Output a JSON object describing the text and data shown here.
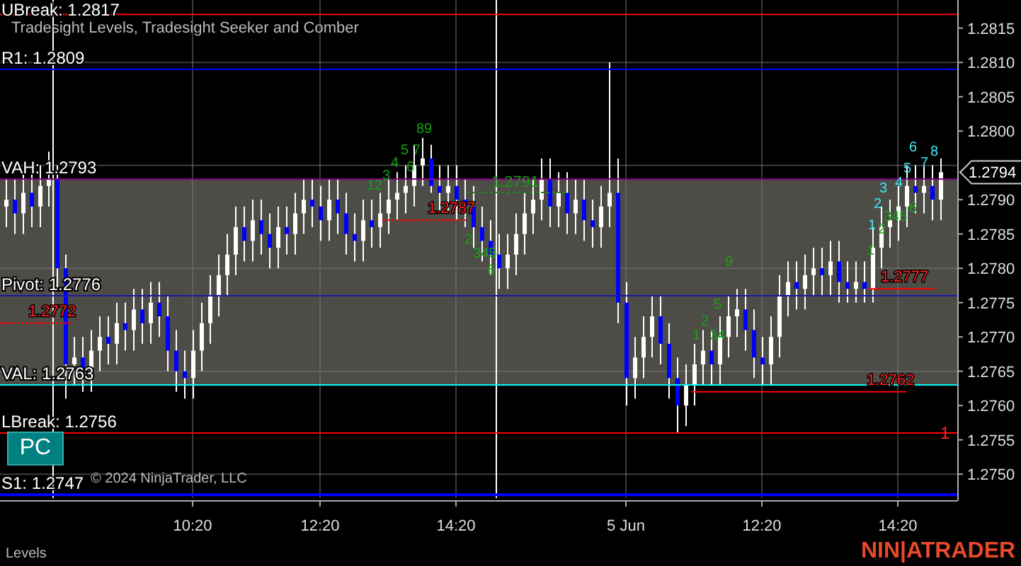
{
  "indicator_title": "Tradesight Levels, Tradesight Seeker and Comber",
  "levels": [
    {
      "name": "UBreak:",
      "price": "1.2817",
      "color": "#ff0000"
    },
    {
      "name": "R1:",
      "price": "1.2809",
      "color": "#0000ff"
    },
    {
      "name": "VAH:",
      "price": "1.2793",
      "color": "#800080"
    },
    {
      "name": "Pivot:",
      "price": "1.2776",
      "color": "#1a1aa8"
    },
    {
      "name": "VAL:",
      "price": "1.2763",
      "color": "#00ffff"
    },
    {
      "name": "LBreak:",
      "price": "1.2756",
      "color": "#ff0000"
    },
    {
      "name": "S1:",
      "price": "1.2747",
      "color": "#0000ff"
    }
  ],
  "red_markers": [
    "1.2787",
    "1.2772",
    "1.2777",
    "1.2762"
  ],
  "green_marker": "1.2791",
  "break_count": "1",
  "green_counts": [
    "89",
    "5 7",
    "4",
    "6",
    "3",
    "12",
    "2",
    "345",
    "6",
    "1",
    "2",
    "34",
    "5",
    "9",
    "1",
    "2",
    "345",
    "6"
  ],
  "cyan_counts": [
    "1",
    "2",
    "3",
    "4",
    "5",
    "6",
    "7",
    "8"
  ],
  "chart_data": {
    "type": "candlestick",
    "categories": [
      null,
      null,
      null,
      null,
      null,
      null,
      null,
      null,
      null,
      null,
      null,
      null,
      null,
      null,
      null,
      null,
      null,
      null,
      null,
      null,
      null,
      null,
      "10:20",
      null,
      null,
      null,
      null,
      null,
      null,
      null,
      null,
      null,
      null,
      null,
      null,
      null,
      null,
      "12:20",
      null,
      null,
      null,
      null,
      null,
      null,
      null,
      null,
      null,
      null,
      null,
      null,
      null,
      null,
      null,
      "14:20",
      null,
      null,
      null,
      null,
      null,
      null,
      null,
      null,
      null,
      null,
      null,
      null,
      null,
      null,
      null,
      null,
      null,
      null,
      null,
      "5 Jun",
      null,
      null,
      null,
      null,
      null,
      null,
      null,
      null,
      null,
      null,
      null,
      null,
      null,
      null,
      null,
      "12:20",
      null,
      null,
      null,
      null,
      null,
      null,
      null,
      null,
      null,
      null,
      null,
      null,
      null,
      null,
      null,
      "14:20",
      null,
      null,
      null,
      null,
      null
    ],
    "ohlc": [
      [
        1.2789,
        1.2793,
        1.2786,
        1.279
      ],
      [
        1.279,
        1.2793,
        1.2785,
        1.2788
      ],
      [
        1.2788,
        1.2794,
        1.2785,
        1.2791
      ],
      [
        1.2791,
        1.2794,
        1.2786,
        1.2789
      ],
      [
        1.2789,
        1.2795,
        1.2786,
        1.2792
      ],
      [
        1.2792,
        1.2797,
        1.2789,
        1.2793
      ],
      [
        1.2793,
        1.2795,
        1.2777,
        1.278
      ],
      [
        1.278,
        1.2782,
        1.2761,
        1.2766
      ],
      [
        1.2766,
        1.277,
        1.2763,
        1.2767
      ],
      [
        1.2767,
        1.277,
        1.2762,
        1.2765
      ],
      [
        1.2765,
        1.2771,
        1.2762,
        1.2768
      ],
      [
        1.2768,
        1.2773,
        1.2765,
        1.277
      ],
      [
        1.277,
        1.2773,
        1.2766,
        1.2769
      ],
      [
        1.2769,
        1.2775,
        1.2766,
        1.2772
      ],
      [
        1.2772,
        1.2775,
        1.2768,
        1.2771
      ],
      [
        1.2771,
        1.2777,
        1.2768,
        1.2774
      ],
      [
        1.2774,
        1.2777,
        1.2769,
        1.2772
      ],
      [
        1.2772,
        1.2778,
        1.2769,
        1.2775
      ],
      [
        1.2775,
        1.2778,
        1.277,
        1.2773
      ],
      [
        1.2773,
        1.2776,
        1.2765,
        1.2768
      ],
      [
        1.2768,
        1.2771,
        1.2762,
        1.2765
      ],
      [
        1.2765,
        1.2768,
        1.2761,
        1.2764
      ],
      [
        1.2764,
        1.2771,
        1.2761,
        1.2768
      ],
      [
        1.2768,
        1.2775,
        1.2765,
        1.2772
      ],
      [
        1.2772,
        1.2779,
        1.2769,
        1.2776
      ],
      [
        1.2776,
        1.2782,
        1.2773,
        1.2779
      ],
      [
        1.2779,
        1.2785,
        1.2776,
        1.2782
      ],
      [
        1.2782,
        1.2789,
        1.2779,
        1.2786
      ],
      [
        1.2786,
        1.2789,
        1.2781,
        1.2784
      ],
      [
        1.2784,
        1.279,
        1.2781,
        1.2787
      ],
      [
        1.2787,
        1.279,
        1.2782,
        1.2785
      ],
      [
        1.2785,
        1.2788,
        1.278,
        1.2783
      ],
      [
        1.2783,
        1.2789,
        1.278,
        1.2786
      ],
      [
        1.2786,
        1.2789,
        1.2782,
        1.2785
      ],
      [
        1.2785,
        1.2791,
        1.2782,
        1.2788
      ],
      [
        1.2788,
        1.2793,
        1.2785,
        1.279
      ],
      [
        1.279,
        1.2793,
        1.2786,
        1.2789
      ],
      [
        1.2789,
        1.2792,
        1.2784,
        1.2787
      ],
      [
        1.2787,
        1.2793,
        1.2784,
        1.279
      ],
      [
        1.279,
        1.2793,
        1.2785,
        1.2788
      ],
      [
        1.2788,
        1.2791,
        1.2782,
        1.2785
      ],
      [
        1.2785,
        1.2788,
        1.2781,
        1.2784
      ],
      [
        1.2784,
        1.279,
        1.2781,
        1.2787
      ],
      [
        1.2787,
        1.279,
        1.2783,
        1.2786
      ],
      [
        1.2786,
        1.2791,
        1.2783,
        1.2788
      ],
      [
        1.2788,
        1.2793,
        1.2785,
        1.279
      ],
      [
        1.279,
        1.2794,
        1.2787,
        1.2791
      ],
      [
        1.2791,
        1.2795,
        1.2788,
        1.2792
      ],
      [
        1.2792,
        1.2798,
        1.2789,
        1.2795
      ],
      [
        1.2795,
        1.2799,
        1.2792,
        1.2796
      ],
      [
        1.2796,
        1.2798,
        1.2791,
        1.2792
      ],
      [
        1.2792,
        1.2795,
        1.2788,
        1.2791
      ],
      [
        1.2791,
        1.2795,
        1.2788,
        1.2792
      ],
      [
        1.2792,
        1.2795,
        1.2787,
        1.279
      ],
      [
        1.279,
        1.2793,
        1.2786,
        1.2789
      ],
      [
        1.2789,
        1.2792,
        1.2783,
        1.2786
      ],
      [
        1.2786,
        1.2789,
        1.2781,
        1.2784
      ],
      [
        1.2784,
        1.2787,
        1.2779,
        1.2782
      ],
      [
        1.2782,
        1.2785,
        1.2777,
        1.278
      ],
      [
        1.278,
        1.2785,
        1.2777,
        1.2782
      ],
      [
        1.2782,
        1.2788,
        1.2779,
        1.2785
      ],
      [
        1.2785,
        1.2791,
        1.2782,
        1.2788
      ],
      [
        1.2788,
        1.2793,
        1.2785,
        1.279
      ],
      [
        1.279,
        1.2796,
        1.2787,
        1.2793
      ],
      [
        1.2793,
        1.2796,
        1.2786,
        1.2789
      ],
      [
        1.2789,
        1.2794,
        1.2786,
        1.2791
      ],
      [
        1.2791,
        1.2794,
        1.2785,
        1.2788
      ],
      [
        1.2788,
        1.2793,
        1.2785,
        1.279
      ],
      [
        1.279,
        1.2793,
        1.2784,
        1.2787
      ],
      [
        1.2787,
        1.279,
        1.2783,
        1.2786
      ],
      [
        1.2786,
        1.2792,
        1.2783,
        1.2789
      ],
      [
        1.2789,
        1.281,
        1.2786,
        1.2791
      ],
      [
        1.2791,
        1.2796,
        1.2772,
        1.2775
      ],
      [
        1.2775,
        1.2778,
        1.276,
        1.2764
      ],
      [
        1.2764,
        1.277,
        1.2761,
        1.2767
      ],
      [
        1.2767,
        1.2773,
        1.2764,
        1.277
      ],
      [
        1.277,
        1.2776,
        1.2767,
        1.2773
      ],
      [
        1.2773,
        1.2776,
        1.2766,
        1.2769
      ],
      [
        1.2769,
        1.2772,
        1.2761,
        1.2764
      ],
      [
        1.2764,
        1.2767,
        1.2756,
        1.276
      ],
      [
        1.276,
        1.2766,
        1.2757,
        1.2763
      ],
      [
        1.2763,
        1.2769,
        1.276,
        1.2766
      ],
      [
        1.2766,
        1.2771,
        1.2763,
        1.2768
      ],
      [
        1.2768,
        1.2771,
        1.2763,
        1.2766
      ],
      [
        1.2766,
        1.2773,
        1.2763,
        1.277
      ],
      [
        1.277,
        1.2776,
        1.2767,
        1.2773
      ],
      [
        1.2773,
        1.2777,
        1.277,
        1.2774
      ],
      [
        1.2774,
        1.2777,
        1.2768,
        1.2771
      ],
      [
        1.2771,
        1.2774,
        1.2764,
        1.2767
      ],
      [
        1.2767,
        1.277,
        1.2763,
        1.2766
      ],
      [
        1.2766,
        1.2773,
        1.2763,
        1.277
      ],
      [
        1.277,
        1.2779,
        1.2767,
        1.2776
      ],
      [
        1.2776,
        1.2781,
        1.2773,
        1.2778
      ],
      [
        1.2778,
        1.2781,
        1.2774,
        1.2777
      ],
      [
        1.2777,
        1.2782,
        1.2774,
        1.2779
      ],
      [
        1.2779,
        1.2783,
        1.2776,
        1.278
      ],
      [
        1.278,
        1.2783,
        1.2776,
        1.2779
      ],
      [
        1.2779,
        1.2784,
        1.2776,
        1.2781
      ],
      [
        1.2781,
        1.2784,
        1.2775,
        1.2778
      ],
      [
        1.2778,
        1.2781,
        1.2775,
        1.2777
      ],
      [
        1.2777,
        1.2781,
        1.2775,
        1.2778
      ],
      [
        1.2778,
        1.2781,
        1.2775,
        1.2777
      ],
      [
        1.2777,
        1.2786,
        1.2775,
        1.2783
      ],
      [
        1.2783,
        1.2789,
        1.278,
        1.2786
      ],
      [
        1.2786,
        1.279,
        1.2783,
        1.2787
      ],
      [
        1.2787,
        1.2792,
        1.2784,
        1.2789
      ],
      [
        1.2789,
        1.2795,
        1.2786,
        1.2792
      ],
      [
        1.2792,
        1.2795,
        1.2788,
        1.2791
      ],
      [
        1.2791,
        1.2795,
        1.2788,
        1.2792
      ],
      [
        1.2792,
        1.2795,
        1.2787,
        1.279
      ],
      [
        1.279,
        1.2796,
        1.2787,
        1.2794
      ]
    ],
    "yticks": [
      {
        "value": 1.2815,
        "label": "1.2815"
      },
      {
        "value": 1.281,
        "label": "1.2810"
      },
      {
        "value": 1.2805,
        "label": "1.2805"
      },
      {
        "value": 1.28,
        "label": "1.2800"
      },
      {
        "value": 1.279,
        "label": "1.2790"
      },
      {
        "value": 1.2785,
        "label": "1.2785"
      },
      {
        "value": 1.278,
        "label": "1.2780"
      },
      {
        "value": 1.2775,
        "label": "1.2775"
      },
      {
        "value": 1.277,
        "label": "1.2770"
      },
      {
        "value": 1.2765,
        "label": "1.2765"
      },
      {
        "value": 1.276,
        "label": "1.2760"
      },
      {
        "value": 1.2755,
        "label": "1.2755"
      },
      {
        "value": 1.275,
        "label": "1.2750"
      }
    ],
    "ylim": [
      1.27461,
      1.28191
    ]
  },
  "current_price": "1.2794",
  "button": "PC",
  "copyright": "© 2024 NinjaTrader, LLC",
  "tab": "Levels",
  "logo": "NIN|ATRADER"
}
